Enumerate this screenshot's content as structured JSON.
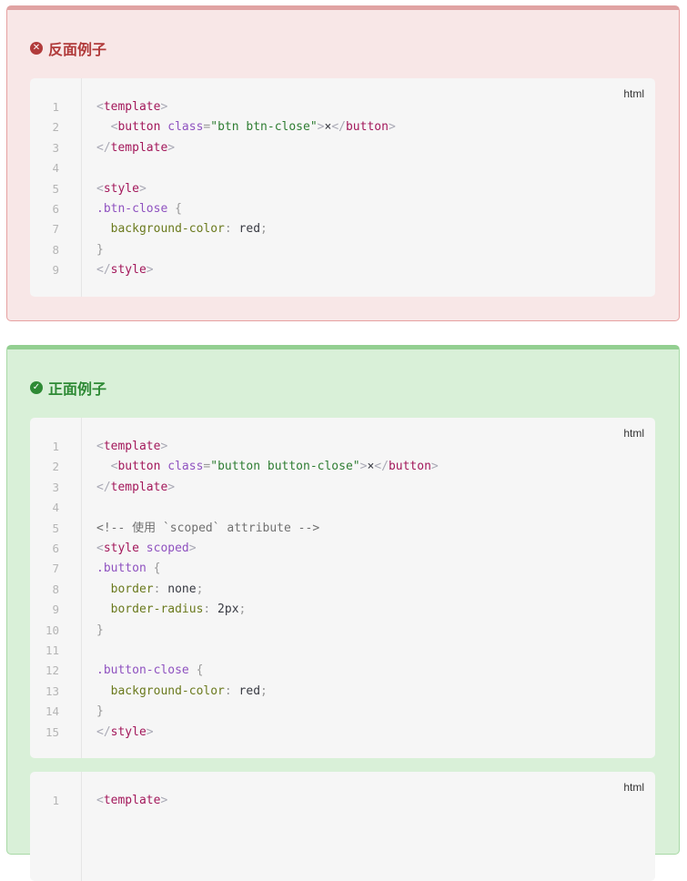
{
  "bad_example": {
    "title": "反面例子",
    "icon": "x-circle-icon",
    "color": "#b13b3b",
    "code": {
      "lang": "html",
      "lines": [
        [
          [
            "tag",
            "<"
          ],
          [
            "name",
            "template"
          ],
          [
            "tag",
            ">"
          ]
        ],
        [
          [
            "val",
            "  "
          ],
          [
            "tag",
            "<"
          ],
          [
            "name",
            "button"
          ],
          [
            "val",
            " "
          ],
          [
            "attr",
            "class"
          ],
          [
            "punc",
            "="
          ],
          [
            "str",
            "\"btn btn-close\""
          ],
          [
            "tag",
            ">"
          ],
          [
            "val",
            "×"
          ],
          [
            "tag",
            "</"
          ],
          [
            "name",
            "button"
          ],
          [
            "tag",
            ">"
          ]
        ],
        [
          [
            "tag",
            "</"
          ],
          [
            "name",
            "template"
          ],
          [
            "tag",
            ">"
          ]
        ],
        [],
        [
          [
            "tag",
            "<"
          ],
          [
            "name",
            "style"
          ],
          [
            "tag",
            ">"
          ]
        ],
        [
          [
            "attr",
            ".btn-close"
          ],
          [
            "val",
            " "
          ],
          [
            "punc",
            "{"
          ]
        ],
        [
          [
            "val",
            "  "
          ],
          [
            "prop",
            "background-color"
          ],
          [
            "punc",
            ":"
          ],
          [
            "val",
            " red"
          ],
          [
            "punc",
            ";"
          ]
        ],
        [
          [
            "punc",
            "}"
          ]
        ],
        [
          [
            "tag",
            "</"
          ],
          [
            "name",
            "style"
          ],
          [
            "tag",
            ">"
          ]
        ]
      ]
    }
  },
  "good_example": {
    "title": "正面例子",
    "icon": "check-circle-icon",
    "color": "#2e8a35",
    "code": {
      "lang": "html",
      "lines": [
        [
          [
            "tag",
            "<"
          ],
          [
            "name",
            "template"
          ],
          [
            "tag",
            ">"
          ]
        ],
        [
          [
            "val",
            "  "
          ],
          [
            "tag",
            "<"
          ],
          [
            "name",
            "button"
          ],
          [
            "val",
            " "
          ],
          [
            "attr",
            "class"
          ],
          [
            "punc",
            "="
          ],
          [
            "str",
            "\"button button-close\""
          ],
          [
            "tag",
            ">"
          ],
          [
            "val",
            "×"
          ],
          [
            "tag",
            "</"
          ],
          [
            "name",
            "button"
          ],
          [
            "tag",
            ">"
          ]
        ],
        [
          [
            "tag",
            "</"
          ],
          [
            "name",
            "template"
          ],
          [
            "tag",
            ">"
          ]
        ],
        [],
        [
          [
            "comment",
            "<!-- 使用 `scoped` attribute -->"
          ]
        ],
        [
          [
            "tag",
            "<"
          ],
          [
            "name",
            "style"
          ],
          [
            "val",
            " "
          ],
          [
            "attr",
            "scoped"
          ],
          [
            "tag",
            ">"
          ]
        ],
        [
          [
            "attr",
            ".button"
          ],
          [
            "val",
            " "
          ],
          [
            "punc",
            "{"
          ]
        ],
        [
          [
            "val",
            "  "
          ],
          [
            "prop",
            "border"
          ],
          [
            "punc",
            ":"
          ],
          [
            "val",
            " none"
          ],
          [
            "punc",
            ";"
          ]
        ],
        [
          [
            "val",
            "  "
          ],
          [
            "prop",
            "border-radius"
          ],
          [
            "punc",
            ":"
          ],
          [
            "val",
            " 2px"
          ],
          [
            "punc",
            ";"
          ]
        ],
        [
          [
            "punc",
            "}"
          ]
        ],
        [],
        [
          [
            "attr",
            ".button-close"
          ],
          [
            "val",
            " "
          ],
          [
            "punc",
            "{"
          ]
        ],
        [
          [
            "val",
            "  "
          ],
          [
            "prop",
            "background-color"
          ],
          [
            "punc",
            ":"
          ],
          [
            "val",
            " red"
          ],
          [
            "punc",
            ";"
          ]
        ],
        [
          [
            "punc",
            "}"
          ]
        ],
        [
          [
            "tag",
            "</"
          ],
          [
            "name",
            "style"
          ],
          [
            "tag",
            ">"
          ]
        ]
      ]
    },
    "code2": {
      "lang": "html",
      "lines": [
        [
          [
            "tag",
            "<"
          ],
          [
            "name",
            "template"
          ],
          [
            "tag",
            ">"
          ]
        ]
      ]
    }
  }
}
